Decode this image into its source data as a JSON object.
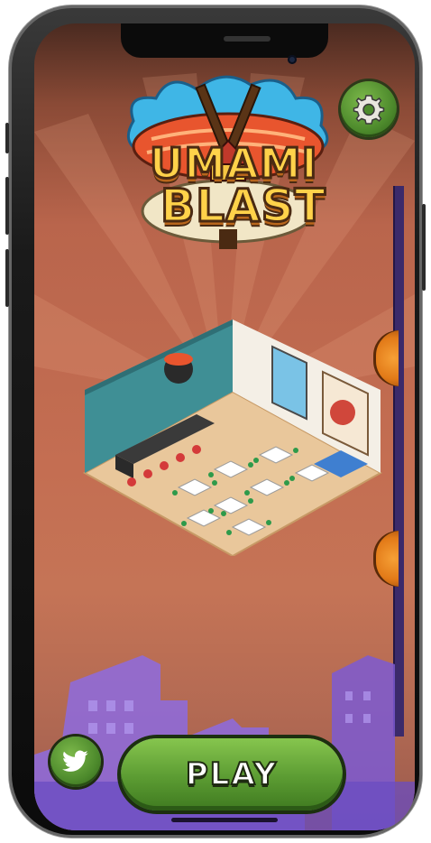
{
  "game": {
    "title_line1": "UMAMI",
    "title_line2": "BLAST"
  },
  "buttons": {
    "play_label": "PLAY",
    "settings_icon": "gear-icon",
    "twitter_icon": "twitter-bird-icon"
  },
  "colors": {
    "background": "#c46e52",
    "button_green": "#5b9b32",
    "logo_yellow": "#ffd24a",
    "side_bar": "#3b2a6a",
    "coin_orange": "#e27a18"
  }
}
